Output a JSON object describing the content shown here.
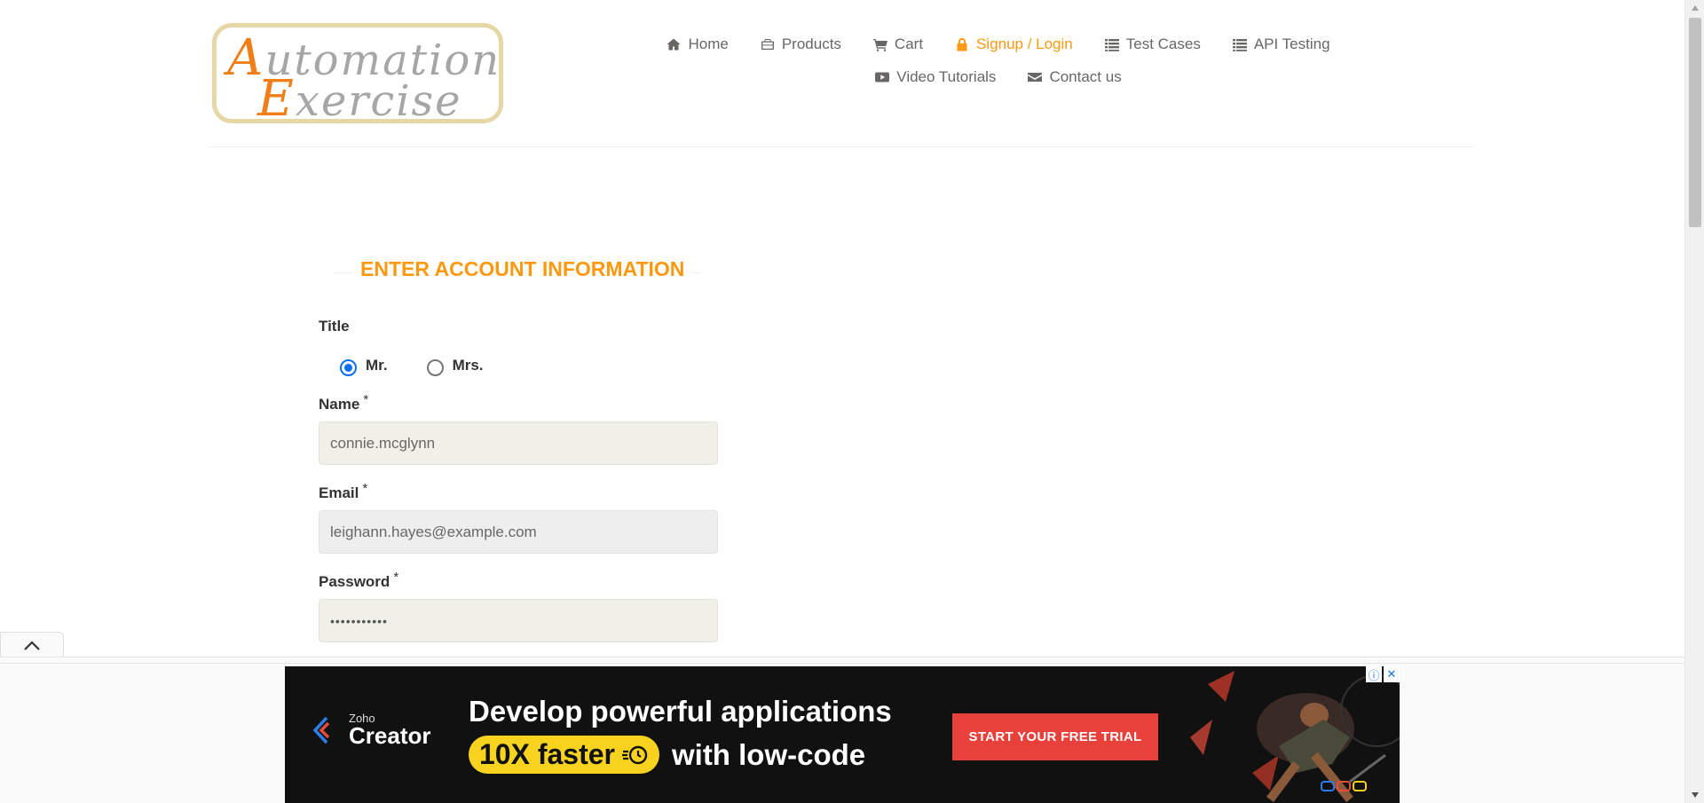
{
  "header": {
    "logo": {
      "line1": "Automation",
      "line2": "Exercise"
    },
    "nav": [
      {
        "label": "Home",
        "icon": "home-icon",
        "active": false
      },
      {
        "label": "Products",
        "icon": "briefcase-icon",
        "active": false
      },
      {
        "label": "Cart",
        "icon": "cart-icon",
        "active": false
      },
      {
        "label": "Signup / Login",
        "icon": "lock-icon",
        "active": true
      },
      {
        "label": "Test Cases",
        "icon": "list-icon",
        "active": false
      },
      {
        "label": "API Testing",
        "icon": "list-icon",
        "active": false
      },
      {
        "label": "Video Tutorials",
        "icon": "youtube-icon",
        "active": false
      },
      {
        "label": "Contact us",
        "icon": "envelope-icon",
        "active": false
      }
    ]
  },
  "form": {
    "heading": "ENTER ACCOUNT INFORMATION",
    "title_label": "Title",
    "title_options": [
      {
        "label": "Mr.",
        "checked": true
      },
      {
        "label": "Mrs.",
        "checked": false
      }
    ],
    "name_label": "Name",
    "name_value": "connie.mcglynn",
    "email_label": "Email",
    "email_value": "leighann.hayes@example.com",
    "password_label": "Password",
    "password_value": "•••••••••••",
    "required_mark": "*"
  },
  "ad": {
    "brand_small": "Zoho",
    "brand_big": "Creator",
    "headline": "Develop powerful applications",
    "pill": "10X faster",
    "subline": "with low-code",
    "cta": "START YOUR FREE TRIAL",
    "info_icon": "info-icon",
    "close_icon": "close-icon"
  },
  "colors": {
    "accent": "#fe980f",
    "text": "#696763",
    "ad_cta": "#e8413b",
    "ad_pill": "#f7d21e"
  }
}
